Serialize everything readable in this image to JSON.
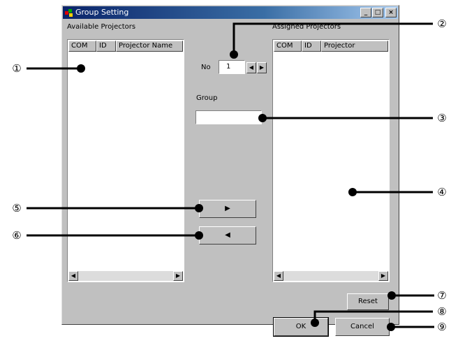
{
  "window": {
    "title": "Group Setting",
    "controls": {
      "minimize": "_",
      "maximize": "□",
      "close": "×"
    }
  },
  "available": {
    "label": "Available Projectors",
    "columns": [
      "COM",
      "ID",
      "Projector Name"
    ]
  },
  "assigned": {
    "label": "Assigned Projectors",
    "columns": [
      "COM",
      "ID",
      "Projector"
    ]
  },
  "number": {
    "label": "No",
    "value": "1"
  },
  "group": {
    "label": "Group",
    "value": ""
  },
  "buttons": {
    "add": "▶",
    "remove": "◀",
    "reset": "Reset",
    "ok": "OK",
    "cancel": "Cancel"
  },
  "scroll": {
    "left": "◀",
    "right": "▶"
  },
  "callouts": [
    "①",
    "②",
    "③",
    "④",
    "⑤",
    "⑥",
    "⑦",
    "⑧",
    "⑨"
  ]
}
